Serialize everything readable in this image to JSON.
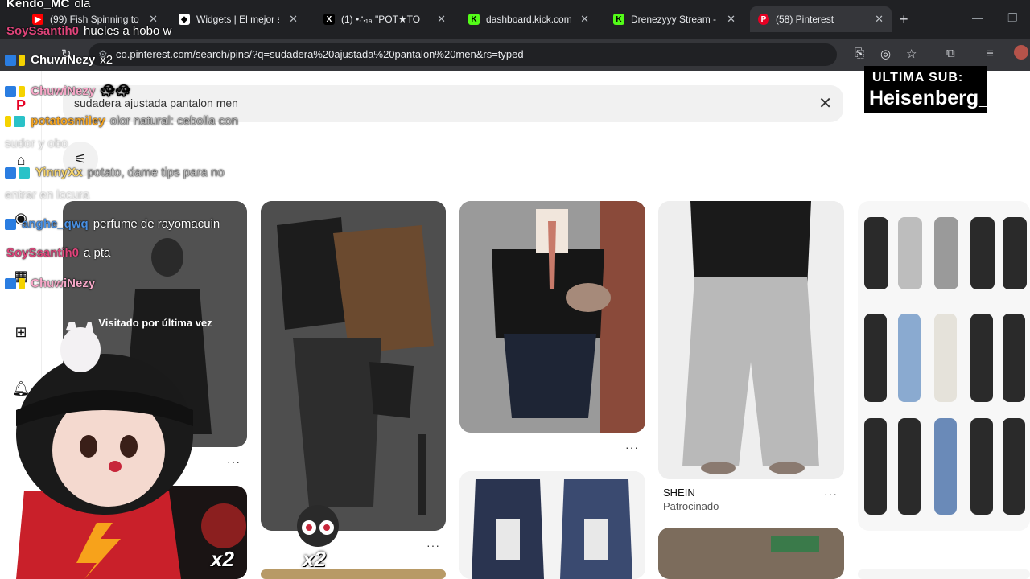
{
  "browser": {
    "tabs": [
      {
        "label": "(99) Fish Spinning to",
        "favicon": "youtube-icon"
      },
      {
        "label": "Widgets | El mejor so",
        "favicon": "widget-icon"
      },
      {
        "label": "(1) •∴₁₉ \"POT★TO",
        "favicon": "x-icon"
      },
      {
        "label": "dashboard.kick.com/",
        "favicon": "kick-icon"
      },
      {
        "label": "Drenezyyy Stream - V",
        "favicon": "kick-icon"
      },
      {
        "label": "(58) Pinterest",
        "favicon": "pinterest-icon"
      }
    ],
    "url": "co.pinterest.com/search/pins/?q=sudadera%20ajustada%20pantalon%20men&rs=typed"
  },
  "pinterest": {
    "search_query": "sudadera ajustada pantalon men",
    "visited_label": "Visitado por última vez",
    "sponsored_brand": "SHEIN",
    "sponsored_label": "Patrocinado",
    "more_label": "···"
  },
  "overlay": {
    "chat": [
      {
        "user": "Kendo_MC",
        "msg": "ola",
        "color": "#ffffff"
      },
      {
        "user": "SoySsantih0",
        "msg": "hueles a hobo w",
        "color": "#e0457b"
      },
      {
        "user": "ChuwiNezy",
        "msg": "x2",
        "color": "#ffffff"
      },
      {
        "user": "ChuwiNezy",
        "msg": "",
        "color": "#f7a8c8"
      },
      {
        "user": "potatosmiley",
        "msg": "olor natural: cebolla con",
        "color": "#f5a623"
      },
      {
        "user": "",
        "msg": "sudor y obo",
        "color": "#cccccc"
      },
      {
        "user": "YinnyXx",
        "msg": "potato, dame tips para no",
        "color": "#f5d36a"
      },
      {
        "user": "",
        "msg": "entrar en locura",
        "color": "#cccccc"
      },
      {
        "user": "anghe_qwq",
        "msg": "perfume de rayomacuin",
        "color": "#4a90e2"
      },
      {
        "user": "SoySsantih0",
        "msg": "a pta",
        "color": "#e0457b"
      },
      {
        "user": "ChuwiNezy",
        "msg": "",
        "color": "#f7a8c8"
      }
    ],
    "last_sub_label": "ULTIMA SUB:",
    "last_sub_name": "Heisenberg_",
    "combo_1": "x2",
    "combo_2": "x2"
  }
}
